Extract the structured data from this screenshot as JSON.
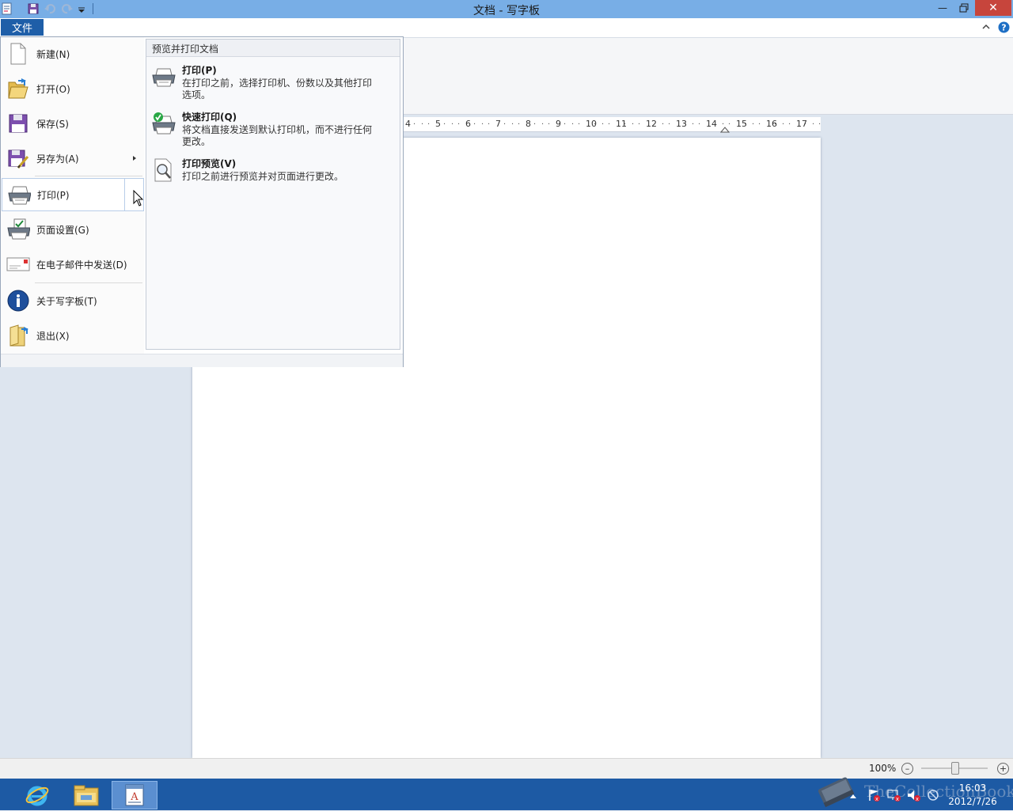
{
  "window": {
    "title": "文档 - 写字板",
    "min_icon": "minimize-icon",
    "restore_icon": "restore-icon",
    "close_icon": "close-icon"
  },
  "ribbon": {
    "file_tab": "文件",
    "help_icon": "help-icon",
    "collapse_icon": "chevron-up-icon"
  },
  "ruler": {
    "numbers": [
      "4",
      "5",
      "6",
      "7",
      "8",
      "9",
      "10",
      "11",
      "12",
      "13",
      "14",
      "15",
      "16",
      "17"
    ]
  },
  "file_menu": {
    "items": [
      {
        "label": "新建(N)",
        "icon": "new-document-icon"
      },
      {
        "label": "打开(O)",
        "icon": "open-folder-icon"
      },
      {
        "label": "保存(S)",
        "icon": "save-icon"
      },
      {
        "label": "另存为(A)",
        "icon": "save-as-icon"
      },
      {
        "label": "打印(P)",
        "icon": "printer-icon"
      },
      {
        "label": "页面设置(G)",
        "icon": "page-setup-icon"
      },
      {
        "label": "在电子邮件中发送(D)",
        "icon": "email-icon"
      },
      {
        "label": "关于写字板(T)",
        "icon": "info-icon"
      },
      {
        "label": "退出(X)",
        "icon": "exit-icon"
      }
    ]
  },
  "print_submenu": {
    "header": "预览并打印文档",
    "items": [
      {
        "title": "打印(P)",
        "desc": "在打印之前，选择打印机、份数以及其他打印选项。",
        "icon": "printer-icon"
      },
      {
        "title": "快速打印(Q)",
        "desc": "将文档直接发送到默认打印机，而不进行任何更改。",
        "icon": "quick-print-icon"
      },
      {
        "title": "打印预览(V)",
        "desc": "打印之前进行预览并对页面进行更改。",
        "icon": "print-preview-icon"
      }
    ]
  },
  "status": {
    "zoom": "100%",
    "zoom_level": 100
  },
  "taskbar": {
    "time": "16:03",
    "date": "2012/7/26",
    "apps": [
      "internet-explorer-icon",
      "file-explorer-icon",
      "wordpad-icon"
    ]
  },
  "watermark": "TheCollectionBook"
}
